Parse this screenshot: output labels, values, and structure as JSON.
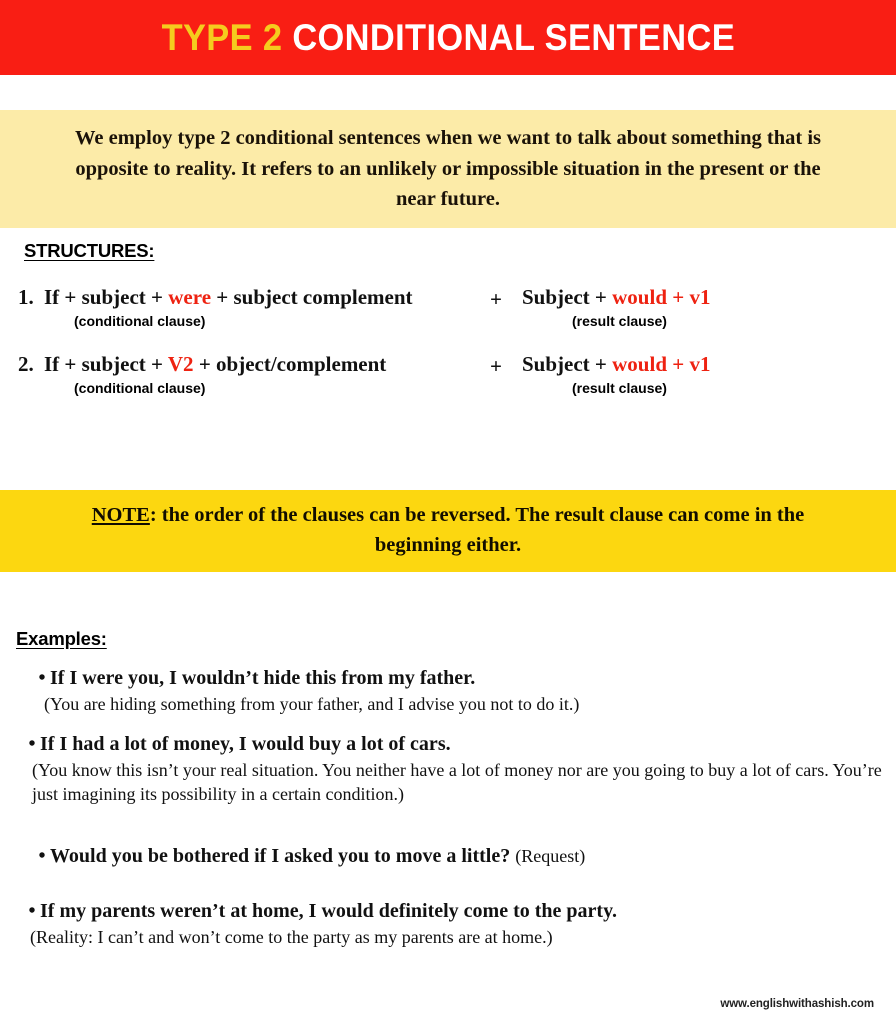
{
  "header": {
    "title_highlight": "TYPE 2",
    "title_rest": " CONDITIONAL SENTENCE",
    "banner_color": "#f91e14",
    "highlight_color": "#f5cc1e"
  },
  "intro": {
    "text": "We employ type 2 conditional sentences when we want to talk about something that is opposite to reality. It refers to an unlikely or impossible situation in the present or the near future.",
    "band_color": "#fceba8"
  },
  "structures": {
    "heading": "STRUCTURES:",
    "items": [
      {
        "number": "1.",
        "left_pre": "If + subject + ",
        "left_highlight": "were",
        "left_post": " + subject complement",
        "left_label": "(conditional clause)",
        "separator": "+",
        "right_pre": "Subject + ",
        "right_highlight": "would + v1",
        "right_post": "",
        "right_label": "(result clause)"
      },
      {
        "number": "2.",
        "left_pre": "If + subject + ",
        "left_highlight": "V2",
        "left_post": " + object/complement",
        "left_label": "(conditional clause)",
        "separator": "+",
        "right_pre": "Subject + ",
        "right_highlight": "would + v1",
        "right_post": "",
        "right_label": "(result clause)"
      }
    ],
    "highlight_color": "#ee2211"
  },
  "note": {
    "label": "NOTE",
    "text": ": the order of the clauses can be reversed. The result clause can come in the beginning either.",
    "band_color": "#fcd710"
  },
  "examples": {
    "heading": "Examples:",
    "bullet": "•",
    "items": [
      {
        "sentence": "If I were you, I wouldn’t hide this from my father.",
        "inline_note": "",
        "explanation": "(You are hiding something from your father, and I advise you not to do it.)"
      },
      {
        "sentence": "If I had a lot of money, I would buy a lot of cars.",
        "inline_note": "",
        "explanation": "(You know this isn’t your real situation. You neither have a lot of money nor are you going to buy a lot of cars. You’re just imagining its possibility in a certain condition.)"
      },
      {
        "sentence": "Would you be bothered if I asked you to move a little?",
        "inline_note": "(Request)",
        "explanation": ""
      },
      {
        "sentence": "If my parents weren’t at home, I would definitely come to the party.",
        "inline_note": "",
        "explanation": "(Reality: I can’t and won’t come to the party as my parents are at home.)"
      }
    ]
  },
  "footer": {
    "website": "www.englishwithashish.com"
  }
}
